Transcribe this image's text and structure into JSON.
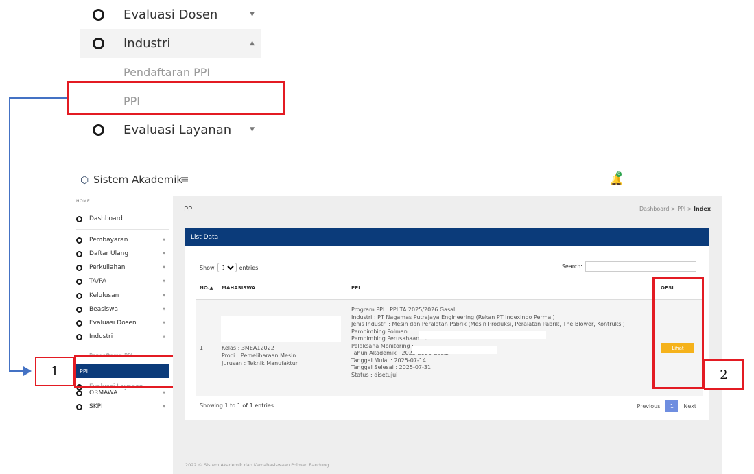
{
  "zoom_menu": {
    "items": [
      {
        "label": "Evaluasi Dosen"
      },
      {
        "label": "Industri"
      },
      {
        "label": "Pendaftaran PPI"
      },
      {
        "label": "PPI"
      },
      {
        "label": "Evaluasi Layanan"
      }
    ]
  },
  "callouts": {
    "one": "1",
    "two": "2"
  },
  "app": {
    "title": "Sistem Akademik",
    "notification_count": "0"
  },
  "sidebar": {
    "home_label": "HOME",
    "items": [
      {
        "label": "Dashboard"
      },
      {
        "label": "Pembayaran"
      },
      {
        "label": "Daftar Ulang"
      },
      {
        "label": "Perkuliahan"
      },
      {
        "label": "TA/PA"
      },
      {
        "label": "Kelulusan"
      },
      {
        "label": "Beasiswa"
      },
      {
        "label": "Evaluasi Dosen"
      },
      {
        "label": "Industri"
      },
      {
        "label": "Pendaftaran PPI"
      },
      {
        "label": "PPI"
      },
      {
        "label": "Evaluasi Layanan"
      },
      {
        "label": "ORMAWA"
      },
      {
        "label": "SKPI"
      }
    ]
  },
  "main": {
    "page_title": "PPI",
    "breadcrumb": {
      "a": "Dashboard",
      "sep": ">",
      "b": "PPI",
      "c": "Index"
    },
    "card_title": "List Data",
    "show": {
      "prefix": "Show",
      "value": "10",
      "suffix": "entries"
    },
    "search_label": "Search:",
    "table": {
      "headers": {
        "no": "NO.",
        "mahasiswa": "MAHASISWA",
        "ppi": "PPI",
        "opsi": "OPSI"
      },
      "sort_indicator": "▲",
      "row": {
        "no": "1",
        "mahasiswa": [
          "Kelas : 3MEA12022",
          "Prodi : Pemeliharaan Mesin",
          "Jurusan : Teknik Manufaktur"
        ],
        "ppi": [
          "Program PPI : PPI TA 2025/2026 Gasal",
          "Industri : PT Nagamas Putrajaya Engineering (Rekan PT Indexindo Permai)",
          "Jenis Industri : Mesin dan Peralatan Pabrik (Mesin Produksi, Peralatan Pabrik, The Blower, Kontruksi)",
          "Pembimbing Polman :",
          "Pembimbing Perusahaan : -",
          "Pelaksana Monitoring :",
          "Tahun Akademik : 2025/2026 Gasal",
          "Tanggal Mulai : 2025-07-14",
          "Tanggal Selesai : 2025-07-31",
          "Status : disetujui"
        ],
        "button": "Lihat"
      }
    },
    "showing_text": "Showing 1 to 1 of 1 entries",
    "pager": {
      "previous": "Previous",
      "current": "1",
      "next": "Next"
    },
    "footer": "2022 © Sistem Akademik dan Kemahasiswaan Polman Bandung"
  },
  "colors": {
    "primary_navy": "#0b3b7a",
    "annotation_red": "#e31b23",
    "connector_blue": "#4472c4",
    "button_yellow": "#f5b21b",
    "pager_active": "#6f8ee0"
  }
}
